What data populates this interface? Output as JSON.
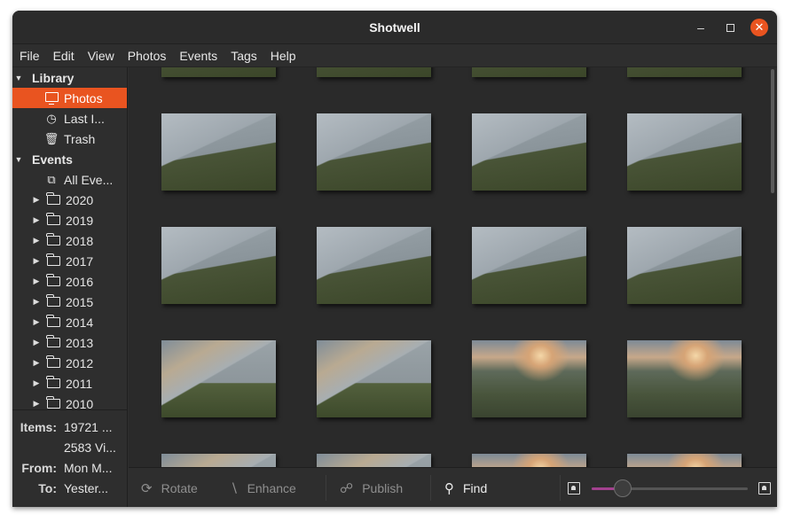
{
  "window": {
    "title": "Shotwell"
  },
  "menu": [
    "File",
    "Edit",
    "View",
    "Photos",
    "Events",
    "Tags",
    "Help"
  ],
  "sidebar": {
    "library_header": "Library",
    "library_items": [
      {
        "label": "Photos",
        "icon": "photos-icon",
        "selected": true
      },
      {
        "label": "Last I...",
        "icon": "clock-icon",
        "selected": false
      },
      {
        "label": "Trash",
        "icon": "trash-icon",
        "selected": false
      }
    ],
    "events_header": "Events",
    "all_events": "All Eve...",
    "years": [
      "2020",
      "2019",
      "2018",
      "2017",
      "2016",
      "2015",
      "2014",
      "2013",
      "2012",
      "2011",
      "2010"
    ]
  },
  "info": {
    "items_label": "Items:",
    "items_value": "19721 ...",
    "videos_value": "2583 Vi...",
    "from_label": "From:",
    "from_value": "Mon M...",
    "to_label": "To:",
    "to_value": "Yester..."
  },
  "photos": {
    "row_themes": [
      "fog",
      "fog",
      "fog",
      "dusk",
      "dusk",
      "fog"
    ]
  },
  "toolbar": {
    "rotate": "Rotate",
    "enhance": "Enhance",
    "publish": "Publish",
    "find": "Find",
    "zoom_level": 0.2
  },
  "colors": {
    "accent": "#e95420",
    "slider": "#a3418f"
  }
}
